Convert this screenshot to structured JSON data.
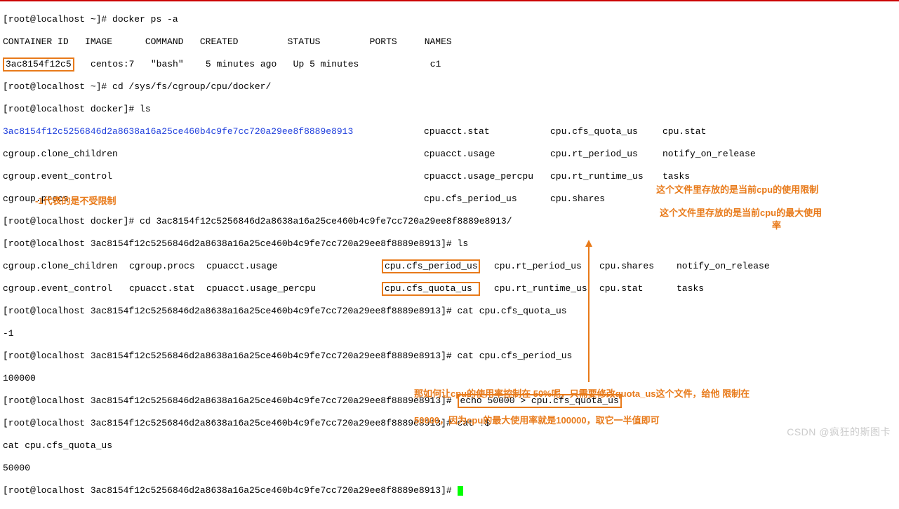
{
  "prompt_home": "[root@localhost ~]# ",
  "prompt_docker": "[root@localhost docker]# ",
  "prompt_long": "[root@localhost 3ac8154f12c5256846d2a8638a16a25ce460b4c9fe7cc720a29ee8f8889e8913]# ",
  "cmd_ps": "docker ps -a",
  "ps_header": "CONTAINER ID   IMAGE      COMMAND   CREATED         STATUS         PORTS     NAMES",
  "ps_row_id": "3ac8154f12c5",
  "ps_row_rest": "   centos:7   \"bash\"    5 minutes ago   Up 5 minutes             c1",
  "cmd_cd1": "cd /sys/fs/cgroup/cpu/docker/",
  "cmd_ls": "ls",
  "dir_hash": "3ac8154f12c5256846d2a8638a16a25ce460b4c9fe7cc720a29ee8f8889e8913",
  "ls1_r1c2": "cpuacct.stat",
  "ls1_r1c3": "cpu.cfs_quota_us",
  "ls1_r1c4": "cpu.stat",
  "ls1_r2c1": "cgroup.clone_children",
  "ls1_r2c2": "cpuacct.usage",
  "ls1_r2c3": "cpu.rt_period_us",
  "ls1_r2c4": "notify_on_release",
  "ls1_r3c1": "cgroup.event_control",
  "ls1_r3c2": "cpuacct.usage_percpu",
  "ls1_r3c3": "cpu.rt_runtime_us",
  "ls1_r3c4": "tasks",
  "ls1_r4c1": "cgroup.procs",
  "ls1_r4c2": "cpu.cfs_period_us",
  "ls1_r4c3": "cpu.shares",
  "cmd_cd2_pre": "cd ",
  "cmd_cd2_suf": "/",
  "ls2_r1c1": "cgroup.clone_children",
  "ls2_r1c2": "cgroup.procs",
  "ls2_r1c3": "cpuacct.usage",
  "ls2_r1c4": "cpu.cfs_period_us",
  "ls2_r1c5": "cpu.rt_period_us",
  "ls2_r1c6": "cpu.shares",
  "ls2_r1c7": "notify_on_release",
  "ls2_r2c1": "cgroup.event_control",
  "ls2_r2c2": "cpuacct.stat",
  "ls2_r2c3": "cpuacct.usage_percpu",
  "ls2_r2c4": "cpu.cfs_quota_us",
  "ls2_r2c5": "cpu.rt_runtime_us",
  "ls2_r2c6": "cpu.stat",
  "ls2_r2c7": "tasks",
  "cmd_cat_quota": "cat cpu.cfs_quota_us",
  "out_minus1": "-1",
  "note_minus1": "-1代表的是不受限制",
  "note_quota": "这个文件里存放的是当前cpu的使用限制",
  "cmd_cat_period": "cat cpu.cfs_period_us",
  "out_100000": "100000",
  "note_period1": "这个文件里存放的是当前cpu的最大使用",
  "note_period2": "率",
  "cmd_echo": "echo 50000 > cpu.cfs_quota_us",
  "cmd_catbang": "cat !$",
  "out_catline": "cat cpu.cfs_quota_us",
  "out_50000": "50000",
  "note_explain1": "那如何让cpu的使用率控制在 50%呢，只需要修改quota_us这个文件，给他  限制在",
  "note_explain2": "50000，因为cpu的最大使用率就是100000，取它一半值即可",
  "watermark": "CSDN @疯狂的斯图卡"
}
